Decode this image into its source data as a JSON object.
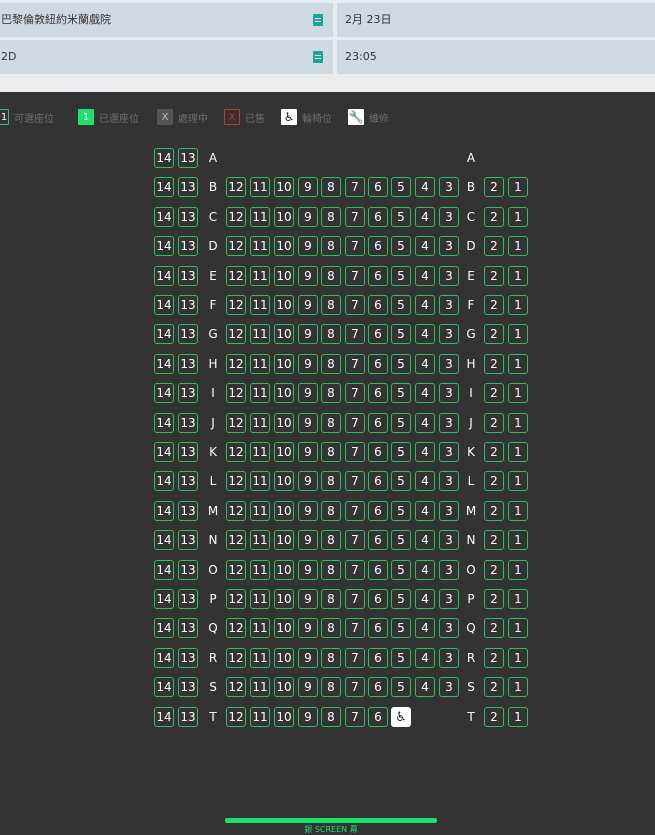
{
  "header": {
    "cinema": "巴黎倫敦紐約米蘭戲院",
    "date": "2月 23日",
    "format": "2D",
    "time": "23:05"
  },
  "legend": [
    {
      "symbol": "1",
      "label": "可選座位",
      "kind": "avail"
    },
    {
      "symbol": "1",
      "label": "已選座位",
      "kind": "sel"
    },
    {
      "symbol": "X",
      "label": "處理中",
      "kind": "proc"
    },
    {
      "symbol": "X",
      "label": "已售",
      "kind": "sold"
    },
    {
      "symbol": "♿",
      "label": "輪椅位",
      "kind": "wc"
    },
    {
      "symbol": "🔧",
      "label": "維修",
      "kind": "maint"
    }
  ],
  "seatmap": {
    "rows": [
      "A",
      "B",
      "C",
      "D",
      "E",
      "F",
      "G",
      "H",
      "I",
      "J",
      "K",
      "L",
      "M",
      "N",
      "O",
      "P",
      "Q",
      "R",
      "S",
      "T"
    ],
    "left_block": [
      "14",
      "13"
    ],
    "middle_block": [
      "12",
      "11",
      "10",
      "9",
      "8",
      "7",
      "6",
      "5",
      "4",
      "3"
    ],
    "right_block": [
      "2",
      "1"
    ],
    "row_a_left_only": true,
    "row_t_middle": [
      "12",
      "11",
      "10",
      "9",
      "8",
      "7",
      "6"
    ],
    "wheelchair_symbol": "♿"
  },
  "screen": {
    "label": "銀 SCREEN 幕"
  },
  "colors": {
    "accent": "#19e36a",
    "seat_border": "#2fbf5f",
    "background": "#333333"
  }
}
